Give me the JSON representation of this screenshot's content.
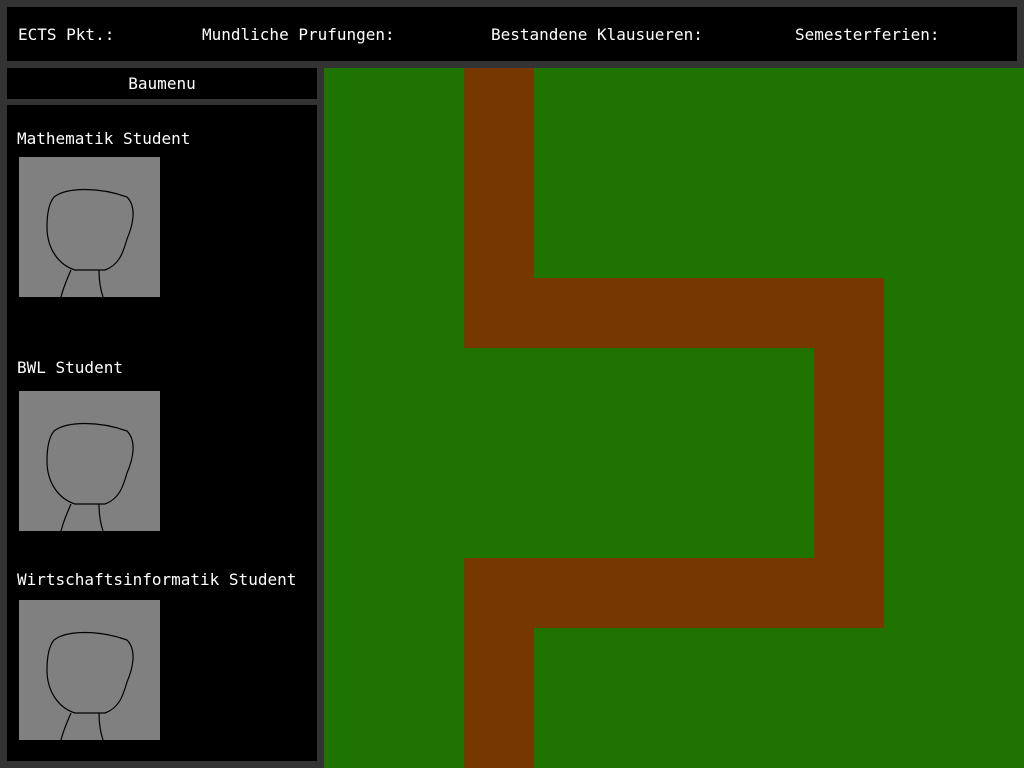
{
  "topbar": {
    "ects": "ECTS Pkt.:",
    "oral_exams": "Mundliche Prufungen:",
    "passed_exams": "Bestandene Klausueren:",
    "semester_break": "Semesterferien:"
  },
  "build_menu": {
    "title": "Baumenu",
    "units": [
      {
        "label": "Mathematik Student",
        "icon": "student-portrait-icon"
      },
      {
        "label": "BWL Student",
        "icon": "student-portrait-icon"
      },
      {
        "label": "Wirtschaftsinformatik Student",
        "icon": "student-portrait-icon"
      }
    ]
  },
  "map": {
    "grass_color": "#1f7300",
    "path_color": "#773800",
    "tile_path": [
      [
        2,
        0
      ],
      [
        2,
        1
      ],
      [
        2,
        2
      ],
      [
        2,
        3
      ],
      [
        3,
        3
      ],
      [
        4,
        3
      ],
      [
        5,
        3
      ],
      [
        6,
        3
      ],
      [
        7,
        3
      ],
      [
        7,
        4
      ],
      [
        7,
        5
      ],
      [
        7,
        6
      ],
      [
        7,
        7
      ],
      [
        6,
        7
      ],
      [
        5,
        7
      ],
      [
        4,
        7
      ],
      [
        3,
        7
      ],
      [
        2,
        7
      ],
      [
        2,
        8
      ],
      [
        2,
        9
      ]
    ]
  },
  "colors": {
    "frame": "#333333",
    "panel": "#000000",
    "portrait_bg": "#808080"
  }
}
